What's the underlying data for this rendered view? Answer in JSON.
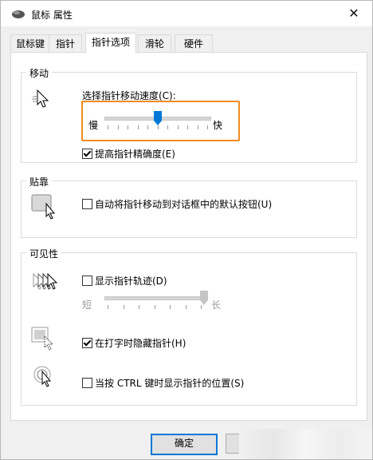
{
  "window": {
    "title": "鼠标 属性",
    "close_symbol": "✕"
  },
  "tabs": [
    {
      "label": "鼠标键",
      "active": false
    },
    {
      "label": "指针",
      "active": false
    },
    {
      "label": "指针选项",
      "active": true
    },
    {
      "label": "滑轮",
      "active": false
    },
    {
      "label": "硬件",
      "active": false
    }
  ],
  "motion": {
    "group_title": "移动",
    "speed_label": "选择指针移动速度(C):",
    "slow_label": "慢",
    "fast_label": "快",
    "speed_level": 0.5,
    "enhance_precision_label": "提高指针精确度(E)",
    "enhance_precision_checked": true
  },
  "snap_to": {
    "group_title": "贴靠",
    "default_button_label": "自动将指针移动到对话框中的默认按钮(U)",
    "default_button_checked": false
  },
  "visibility": {
    "group_title": "可见性",
    "trails_label": "显示指针轨迹(D)",
    "trails_checked": false,
    "short_label": "短",
    "long_label": "长",
    "trails_level": 1.0,
    "hide_typing_label": "在打字时隐藏指针(H)",
    "hide_typing_checked": true,
    "show_location_label": "当按 CTRL 键时显示指针的位置(S)",
    "show_location_checked": false
  },
  "buttons": {
    "ok_label": "确定"
  },
  "colors": {
    "accent": "#0078d7",
    "highlight": "#f08a24"
  }
}
